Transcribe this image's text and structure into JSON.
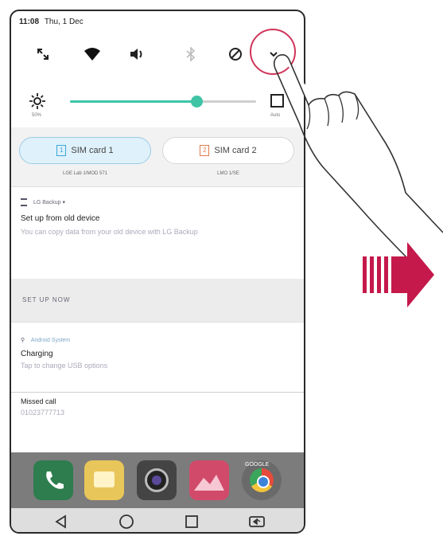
{
  "status_bar": {
    "time": "11:08",
    "date": "Thu, 1 Dec"
  },
  "quick_settings": {
    "icons": [
      "screen-rotate-icon",
      "wifi-icon",
      "sound-icon",
      "bluetooth-icon",
      "do-not-disturb-icon",
      "expand-icon"
    ],
    "brightness_label": "50%",
    "brightness_level": 0.68,
    "auto_label": "Auto"
  },
  "sim_cards": [
    {
      "number": "1",
      "label": "SIM card 1",
      "sub": "LGE Lab 1/MOD 571",
      "active": true
    },
    {
      "number": "2",
      "label": "SIM card 2",
      "sub": "LMO 1/SE",
      "active": false
    }
  ],
  "notifications": [
    {
      "app": "LG Backup",
      "title": "Set up from old device",
      "body": "You can copy data from your old device with LG Backup"
    },
    {
      "app": "Android System",
      "title": "Charging",
      "body": "Tap to change USB options"
    },
    {
      "app": "",
      "title": "Missed call",
      "body": "01023777713"
    }
  ],
  "action_button": "SET UP NOW",
  "dock_apps": [
    "phone-app-icon",
    "messaging-app-icon",
    "camera-app-icon",
    "gallery-app-icon",
    "chrome-app-icon"
  ],
  "dock_folder_label": "GOOGLE",
  "nav_buttons": [
    "back-icon",
    "home-icon",
    "recents-icon",
    "dual-window-icon"
  ],
  "colors": {
    "accent": "#3fc4a6",
    "highlight": "#d0345a",
    "sim1": "#3aa6d8",
    "sim2": "#e07a4a"
  }
}
